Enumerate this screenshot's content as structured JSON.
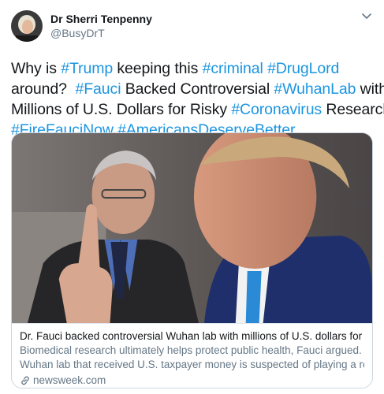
{
  "author": {
    "display_name": "Dr Sherri Tenpenny",
    "handle": "@BusyDrT"
  },
  "tweet": {
    "lines": [
      [
        {
          "t": "Why is ",
          "tag": false
        },
        {
          "t": "#Trump",
          "tag": true
        },
        {
          "t": " keeping this ",
          "tag": false
        },
        {
          "t": "#criminal",
          "tag": true
        },
        {
          "t": " ",
          "tag": false
        },
        {
          "t": "#DrugLord",
          "tag": true
        }
      ],
      [
        {
          "t": "around?  ",
          "tag": false
        },
        {
          "t": "#Fauci",
          "tag": true
        },
        {
          "t": " Backed Controversial ",
          "tag": false
        },
        {
          "t": "#WuhanLab",
          "tag": true
        },
        {
          "t": " with",
          "tag": false
        }
      ],
      [
        {
          "t": "Millions of U.S. Dollars for Risky ",
          "tag": false
        },
        {
          "t": "#Coronavirus",
          "tag": true
        },
        {
          "t": " Research",
          "tag": false
        }
      ],
      [
        {
          "t": "#FireFauciNow",
          "tag": true
        },
        {
          "t": " ",
          "tag": false
        },
        {
          "t": "#AmericansDeserveBetter",
          "tag": true
        }
      ]
    ]
  },
  "card": {
    "title": "Dr. Fauci backed controversial Wuhan lab with millions of U.S. dollars for risky co...",
    "description_line1": "Biomedical research ultimately helps protect public health, Fauci argued. The",
    "description_line2": "Wuhan lab that received U.S. taxpayer money is suspected of playing a role in ...",
    "domain": "newsweek.com"
  },
  "icons": {
    "menu": "chevron-down-icon",
    "link": "link-icon"
  },
  "colors": {
    "hashtag": "#1b95e0",
    "secondary_text": "#657786",
    "primary_text": "#14171a",
    "border": "#ccd6dd"
  }
}
